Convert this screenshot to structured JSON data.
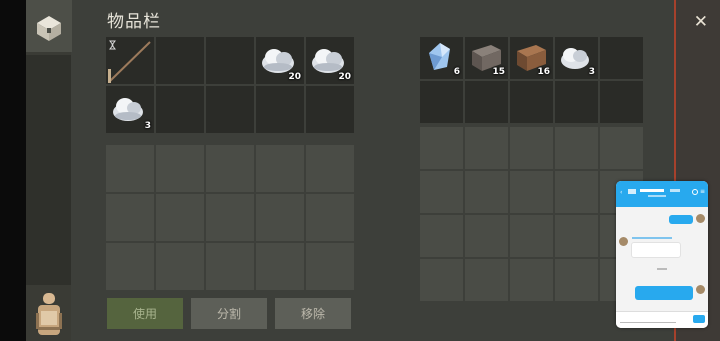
{
  "title": "物品栏",
  "inventory": {
    "slots": [
      {
        "item": "broom",
        "icon": "broom-icon"
      },
      {
        "item": "",
        "icon": ""
      },
      {
        "item": "",
        "icon": ""
      },
      {
        "item": "salt",
        "icon": "salt-pile-icon",
        "qty": "20"
      },
      {
        "item": "salt",
        "icon": "salt-pile-icon",
        "qty": "20"
      },
      {
        "item": "salt",
        "icon": "salt-pile-icon",
        "qty": "3"
      }
    ]
  },
  "storage": {
    "slots": [
      {
        "item": "crystal",
        "icon": "crystal-icon",
        "qty": "6"
      },
      {
        "item": "stone",
        "icon": "stone-block-icon",
        "qty": "15"
      },
      {
        "item": "clay",
        "icon": "clay-block-icon",
        "qty": "16"
      },
      {
        "item": "salt",
        "icon": "salt-pile-icon",
        "qty": "3"
      }
    ]
  },
  "buttons": {
    "use": "使用",
    "split": "分割",
    "remove": "移除"
  },
  "colors": {
    "accent_close": "#a6412c",
    "chat_blue": "#28a9ee",
    "use_button": "#55643e"
  }
}
